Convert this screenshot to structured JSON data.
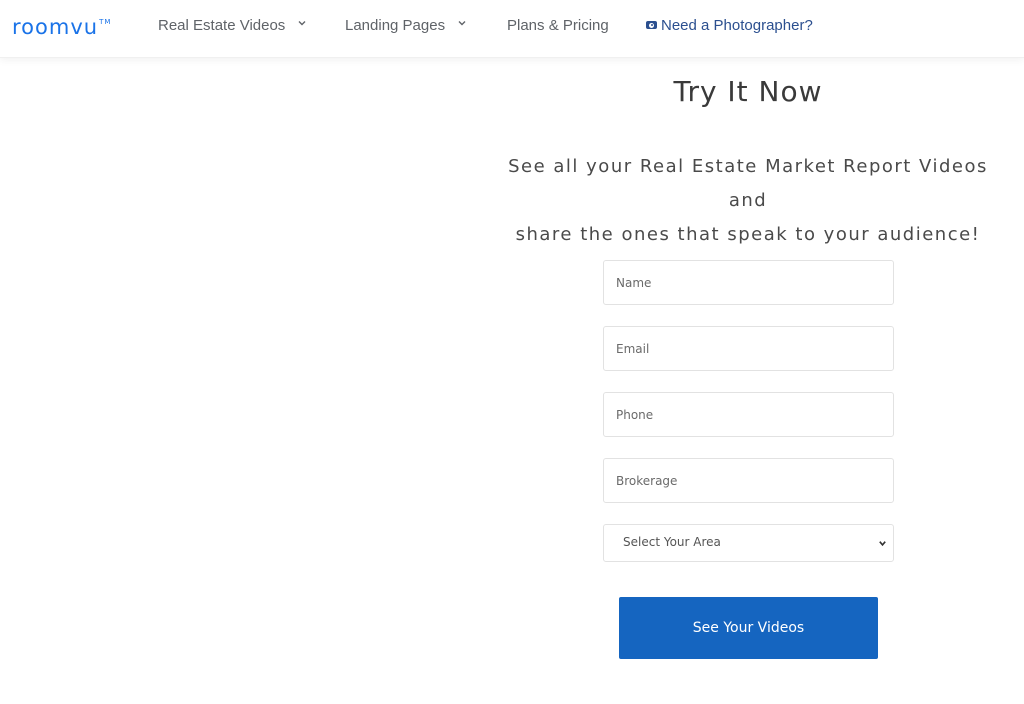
{
  "navbar": {
    "logo": "roomvu",
    "logo_tm": "TM",
    "items": [
      {
        "label": "Real Estate Videos",
        "has_dropdown": true
      },
      {
        "label": "Landing Pages",
        "has_dropdown": true
      },
      {
        "label": "Plans & Pricing",
        "has_dropdown": false
      },
      {
        "label": "Need a Photographer?",
        "icon": "camera-icon"
      }
    ]
  },
  "hero": {
    "title": "Try It Now",
    "subtitle_line1": "See all your Real Estate Market Report Videos and",
    "subtitle_line2": "share the ones that speak to your audience!"
  },
  "form": {
    "name_placeholder": "Name",
    "email_placeholder": "Email",
    "phone_placeholder": "Phone",
    "brokerage_placeholder": "Brokerage",
    "area_select": "Select Your Area",
    "submit_label": "See Your Videos"
  },
  "colors": {
    "brand": "#1a73e8",
    "button": "#1565c0",
    "photographer_link": "#2b4f8f"
  }
}
